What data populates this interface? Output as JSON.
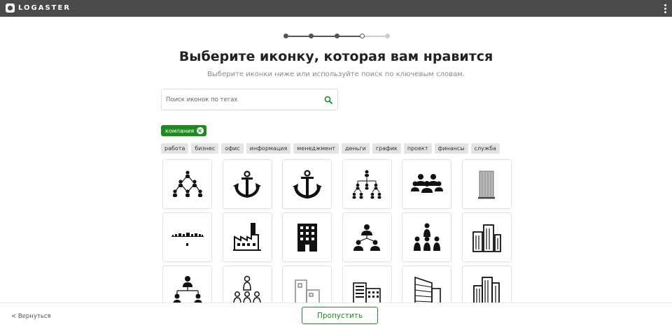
{
  "header": {
    "brand": "LOGASTER",
    "bg_color": "#4a4a4a"
  },
  "progress": {
    "total_steps": 5,
    "current_step": 4,
    "active_color": "#555555",
    "inactive_color": "#cccccc"
  },
  "page": {
    "title": "Выберите иконку, которая вам нравится",
    "subtitle": "Выберите иконки ниже или используйте поиск по ключевым словам."
  },
  "search": {
    "placeholder": "Поиск иконок по тегах",
    "value": ""
  },
  "active_tag": {
    "label": "компания",
    "color": "#1f8a1f"
  },
  "tags": [
    "работа",
    "бизнес",
    "офис",
    "информация",
    "менеджмент",
    "деньги",
    "график",
    "проект",
    "финансы",
    "служба"
  ],
  "icons": [
    "org-network-icon",
    "anchor-icon",
    "anchor-icon",
    "org-chart-icon",
    "team-group-icon",
    "skyscraper-icon",
    "city-skyline-icon",
    "factory-icon",
    "office-building-icon",
    "team-network-icon",
    "leader-team-icon",
    "buildings-icon",
    "hierarchy-icon",
    "team-leader-icon",
    "office-outline-icon",
    "office-complex-icon",
    "modern-building-icon",
    "tower-building-icon"
  ],
  "footer": {
    "back_label": "< Вернуться",
    "skip_label": "Пропустить",
    "accent": "#1f8a1f"
  }
}
